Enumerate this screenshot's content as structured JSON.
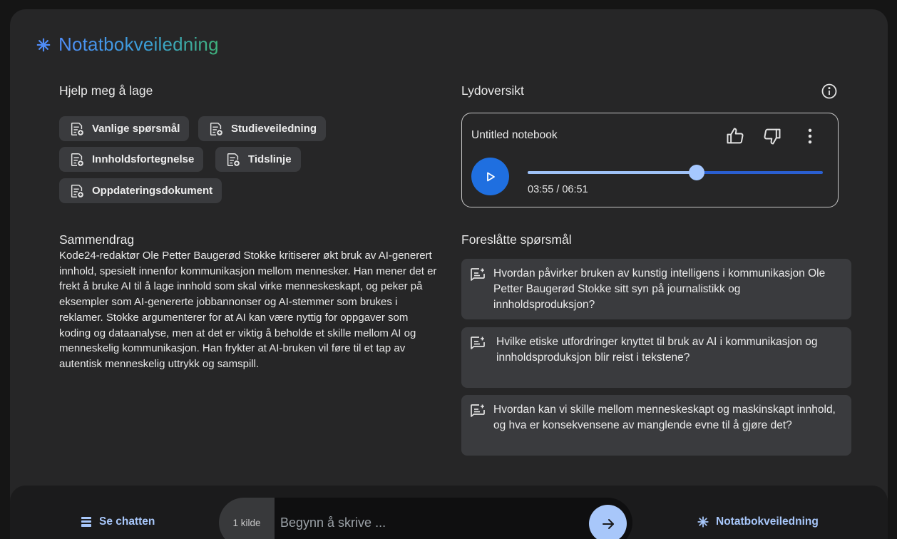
{
  "header": {
    "title": "Notatbokveiledning",
    "icon": "sparkle-icon"
  },
  "help": {
    "title": "Hjelp meg å lage",
    "chips": [
      {
        "label": "Vanlige spørsmål",
        "icon": "note-add-icon"
      },
      {
        "label": "Studieveiledning",
        "icon": "note-add-icon"
      },
      {
        "label": "Innholdsfortegnelse",
        "icon": "note-add-icon"
      },
      {
        "label": "Tidslinje",
        "icon": "note-add-icon"
      },
      {
        "label": "Oppdateringsdokument",
        "icon": "note-add-icon"
      }
    ]
  },
  "summary": {
    "title": "Sammendrag",
    "text": "Kode24-redaktør Ole Petter Baugerød Stokke kritiserer økt bruk av AI-generert innhold, spesielt innenfor kommunikasjon mellom mennesker. Han mener det er frekt å bruke AI til å lage innhold som skal virke menneskeskapt, og peker på eksempler som AI-genererte jobbannonser og AI-stemmer som brukes i reklamer. Stokke argumenterer for at AI kan være nyttig for oppgaver som koding og dataanalyse, men at det er viktig å beholde et skille mellom AI og menneskelig kommunikasjon. Han frykter at AI-bruken vil føre til et tap av autentisk menneskelig uttrykk og samspill."
  },
  "audio": {
    "title": "Lydoversikt",
    "notebook_title": "Untitled notebook",
    "current_time": "03:55",
    "total_time": "06:51",
    "time_display": "03:55 / 06:51",
    "progress": 0.572,
    "icons": [
      "info-icon",
      "thumb-up-icon",
      "thumb-down-icon",
      "more-vert-icon",
      "play-icon"
    ]
  },
  "suggested": {
    "title": "Foreslåtte spørsmål",
    "questions": [
      "Hvordan påvirker bruken av kunstig intelligens i kommunikasjon Ole Petter Baugerød Stokke sitt syn på journalistikk og innholdsproduksjon?",
      "Hvilke etiske utfordringer knyttet til bruk av AI i kommunikasjon og innholdsproduksjon blir reist i tekstene?",
      "Hvordan kan vi skille mellom menneskeskapt og maskinskapt innhold, og hva er konsekvensene av manglende evne til å gjøre det?"
    ]
  },
  "bottom": {
    "chat_link": "Se chatten",
    "source_count": "1 kilde",
    "input_placeholder": "Begynn å skrive ...",
    "guide_link": "Notatbokveiledning"
  },
  "colors": {
    "accent": "#a8c7fa",
    "play": "#1f6fe0",
    "panel": "#262627",
    "chip": "#3a3b3e"
  }
}
